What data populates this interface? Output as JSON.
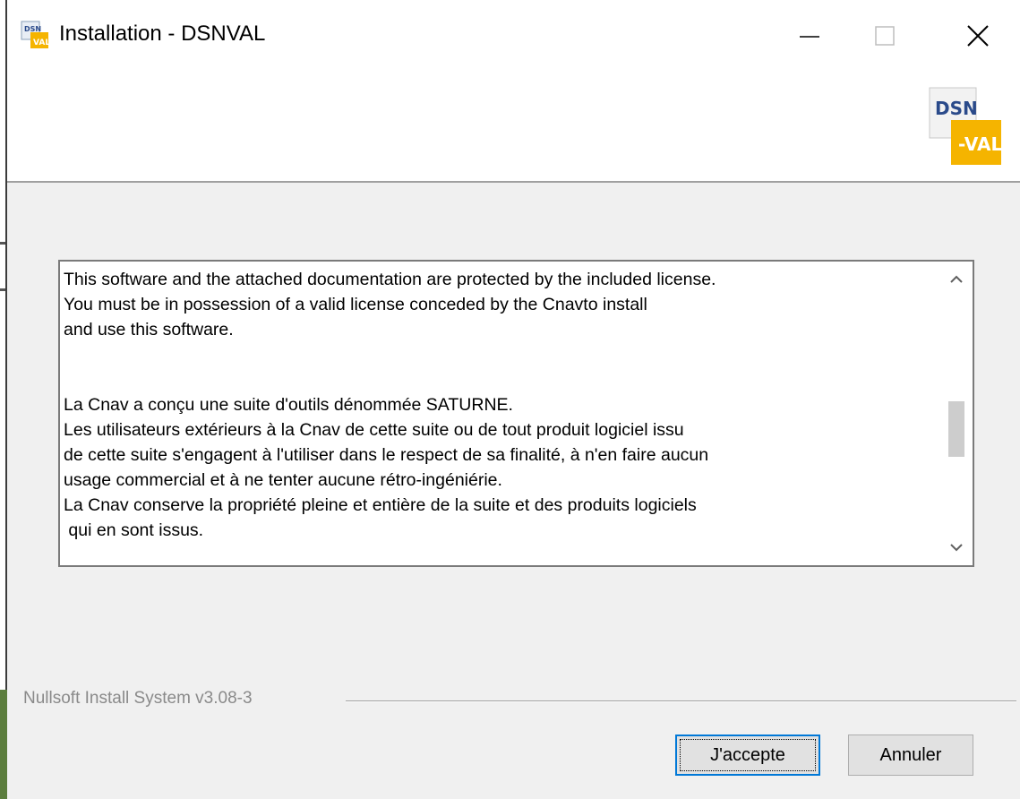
{
  "window": {
    "title": "Installation - DSNVAL",
    "icon": "dsnval-app-icon"
  },
  "controls": {
    "minimize_icon": "minimize-icon",
    "maximize_icon": "maximize-icon",
    "close_icon": "close-icon"
  },
  "header": {
    "logo": "dsnval-logo",
    "logo_text_top": "DSN",
    "logo_text_bottom": "-VAL"
  },
  "license": {
    "lines": [
      "This software and the attached documentation are protected by the included license.",
      "You must be in possession of a valid license conceded by the Cnavto install",
      "and use this software.",
      "",
      "",
      "La Cnav a conçu une suite d'outils dénommée SATURNE.",
      "Les utilisateurs extérieurs à la Cnav de cette suite ou de tout produit logiciel issu",
      "de cette suite s'engagent à l'utiliser dans le respect de sa finalité, à n'en faire aucun",
      "usage commercial et à ne tenter aucune rétro-ingéniérie.",
      "La Cnav conserve la propriété pleine et entière de la suite et des produits logiciels",
      " qui en sont issus."
    ]
  },
  "scrollbar": {
    "up_icon": "chevron-up-icon",
    "down_icon": "chevron-down-icon"
  },
  "branding": {
    "text": "Nullsoft Install System v3.08-3"
  },
  "buttons": {
    "accept": "J'accepte",
    "cancel": "Annuler"
  },
  "colors": {
    "accent": "#0078d7",
    "logo_yellow": "#f5b400"
  }
}
